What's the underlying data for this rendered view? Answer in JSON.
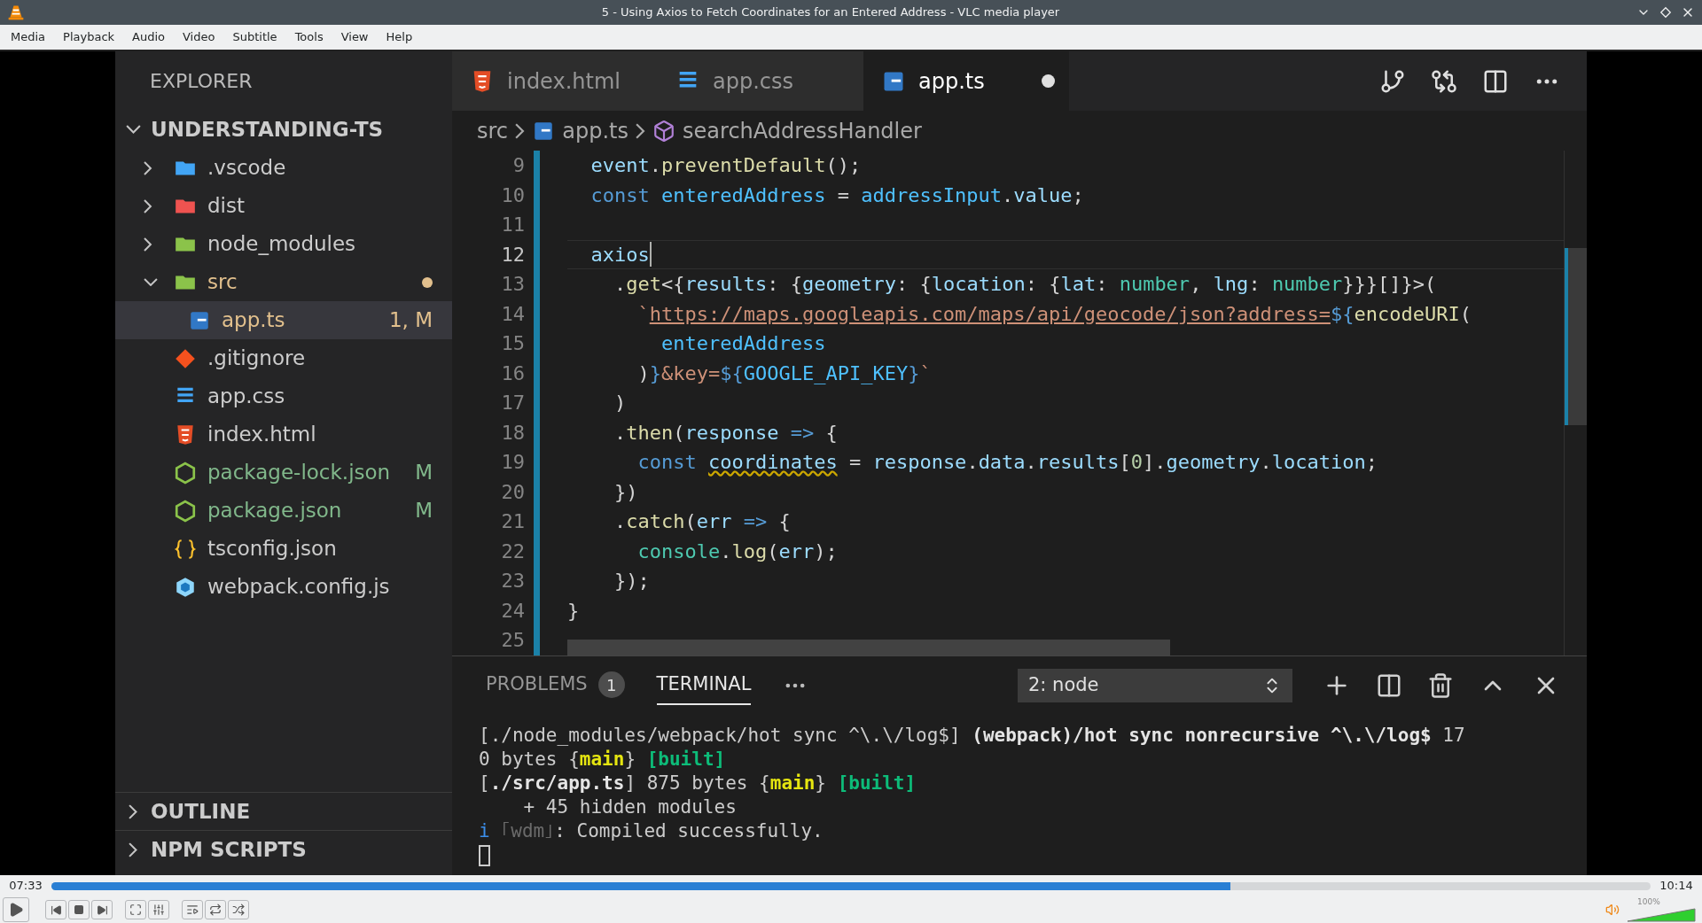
{
  "window": {
    "title": "5 - Using Axios to Fetch Coordinates for an Entered Address - VLC media player"
  },
  "menu": [
    "Media",
    "Playback",
    "Audio",
    "Video",
    "Subtitle",
    "Tools",
    "View",
    "Help"
  ],
  "explorer": {
    "title": "EXPLORER",
    "root": {
      "label": "UNDERSTANDING-TS",
      "expanded": true,
      "children": [
        {
          "label": ".vscode",
          "kind": "folder-blue",
          "expanded": false,
          "selected": false
        },
        {
          "label": "dist",
          "kind": "folder-red",
          "expanded": false,
          "selected": false
        },
        {
          "label": "node_modules",
          "kind": "folder-green",
          "expanded": false,
          "selected": false
        },
        {
          "label": "src",
          "kind": "folder-green",
          "expanded": true,
          "selected": false,
          "modified": true,
          "color": "#e2c08d",
          "children": [
            {
              "label": "app.ts",
              "kind": "ts",
              "selected": true,
              "color": "#e2c08d",
              "status": "1, M"
            }
          ]
        },
        {
          "label": ".gitignore",
          "kind": "git",
          "selected": false
        },
        {
          "label": "app.css",
          "kind": "css",
          "selected": false
        },
        {
          "label": "index.html",
          "kind": "html",
          "selected": false
        },
        {
          "label": "package-lock.json",
          "kind": "node",
          "selected": false,
          "color": "#81b88b",
          "status": "M"
        },
        {
          "label": "package.json",
          "kind": "node",
          "selected": false,
          "color": "#81b88b",
          "status": "M"
        },
        {
          "label": "tsconfig.json",
          "kind": "json",
          "selected": false
        },
        {
          "label": "webpack.config.js",
          "kind": "webpack",
          "selected": false
        }
      ]
    },
    "sections": [
      {
        "label": "OUTLINE",
        "expanded": false
      },
      {
        "label": "NPM SCRIPTS",
        "expanded": false
      }
    ]
  },
  "tabs": [
    {
      "label": "index.html",
      "kind": "html",
      "selected": false,
      "modified": false
    },
    {
      "label": "app.css",
      "kind": "css",
      "selected": false,
      "modified": false
    },
    {
      "label": "app.ts",
      "kind": "ts",
      "selected": true,
      "modified": true
    }
  ],
  "breadcrumb": [
    {
      "label": "src",
      "kind": "folder"
    },
    {
      "label": "app.ts",
      "kind": "ts"
    },
    {
      "label": "searchAddressHandler",
      "kind": "symbol"
    }
  ],
  "code": {
    "lines": [
      {
        "number": "9",
        "active": false,
        "tokens": [
          {
            "text": "  event",
            "kind": "var"
          },
          {
            "text": ".",
            "kind": "plain"
          },
          {
            "text": "preventDefault",
            "kind": "fn"
          },
          {
            "text": "();",
            "kind": "plain"
          }
        ]
      },
      {
        "number": "10",
        "active": false,
        "tokens": [
          {
            "text": "  const",
            "kind": "kw"
          },
          {
            "text": " enteredAddress",
            "kind": "const"
          },
          {
            "text": " = ",
            "kind": "plain"
          },
          {
            "text": "addressInput",
            "kind": "const"
          },
          {
            "text": ".",
            "kind": "plain"
          },
          {
            "text": "value",
            "kind": "var"
          },
          {
            "text": ";",
            "kind": "plain"
          }
        ]
      },
      {
        "number": "11",
        "active": false
      },
      {
        "number": "12",
        "active": true,
        "tokens": [
          {
            "text": "  axios",
            "kind": "var"
          }
        ]
      },
      {
        "number": "13",
        "active": false,
        "tokens": [
          {
            "text": "    .",
            "kind": "plain"
          },
          {
            "text": "get",
            "kind": "fn"
          },
          {
            "text": "<{",
            "kind": "plain"
          },
          {
            "text": "results",
            "kind": "var"
          },
          {
            "text": ": {",
            "kind": "plain"
          },
          {
            "text": "geometry",
            "kind": "var"
          },
          {
            "text": ": {",
            "kind": "plain"
          },
          {
            "text": "location",
            "kind": "var"
          },
          {
            "text": ": {",
            "kind": "plain"
          },
          {
            "text": "lat",
            "kind": "var"
          },
          {
            "text": ": ",
            "kind": "plain"
          },
          {
            "text": "number",
            "kind": "type"
          },
          {
            "text": ", ",
            "kind": "plain"
          },
          {
            "text": "lng",
            "kind": "var"
          },
          {
            "text": ": ",
            "kind": "plain"
          },
          {
            "text": "number",
            "kind": "type"
          },
          {
            "text": "}}}[]}>(",
            "kind": "plain"
          }
        ]
      },
      {
        "number": "14",
        "active": false,
        "tokens": [
          {
            "text": "      `",
            "kind": "str"
          },
          {
            "text": "https://maps.googleapis.com/maps/api/geocode/json?address=",
            "kind": "link"
          },
          {
            "text": "${",
            "kind": "tmpl"
          },
          {
            "text": "encodeURI",
            "kind": "fn"
          },
          {
            "text": "(",
            "kind": "plain"
          }
        ]
      },
      {
        "number": "15",
        "active": false,
        "tokens": [
          {
            "text": "        enteredAddress",
            "kind": "const"
          }
        ]
      },
      {
        "number": "16",
        "active": false,
        "tokens": [
          {
            "text": "      )",
            "kind": "plain"
          },
          {
            "text": "}",
            "kind": "tmpl"
          },
          {
            "text": "&key=",
            "kind": "str"
          },
          {
            "text": "${",
            "kind": "tmpl"
          },
          {
            "text": "GOOGLE_API_KEY",
            "kind": "const"
          },
          {
            "text": "}",
            "kind": "tmpl"
          },
          {
            "text": "`",
            "kind": "str"
          }
        ]
      },
      {
        "number": "17",
        "active": false,
        "tokens": [
          {
            "text": "    )",
            "kind": "plain"
          }
        ]
      },
      {
        "number": "18",
        "active": false,
        "tokens": [
          {
            "text": "    .",
            "kind": "plain"
          },
          {
            "text": "then",
            "kind": "fn"
          },
          {
            "text": "(",
            "kind": "plain"
          },
          {
            "text": "response",
            "kind": "var"
          },
          {
            "text": " =>",
            "kind": "kw"
          },
          {
            "text": " {",
            "kind": "plain"
          }
        ]
      },
      {
        "number": "19",
        "active": false,
        "tokens": [
          {
            "text": "      const ",
            "kind": "kw"
          },
          {
            "text": "coordinates",
            "kind": "warn"
          },
          {
            "text": " = ",
            "kind": "plain"
          },
          {
            "text": "response",
            "kind": "var"
          },
          {
            "text": ".",
            "kind": "plain"
          },
          {
            "text": "data",
            "kind": "var"
          },
          {
            "text": ".",
            "kind": "plain"
          },
          {
            "text": "results",
            "kind": "var"
          },
          {
            "text": "[",
            "kind": "plain"
          },
          {
            "text": "0",
            "kind": "num"
          },
          {
            "text": "].",
            "kind": "plain"
          },
          {
            "text": "geometry",
            "kind": "var"
          },
          {
            "text": ".",
            "kind": "plain"
          },
          {
            "text": "location",
            "kind": "var"
          },
          {
            "text": ";",
            "kind": "plain"
          }
        ]
      },
      {
        "number": "20",
        "active": false,
        "tokens": [
          {
            "text": "    })",
            "kind": "plain"
          }
        ]
      },
      {
        "number": "21",
        "active": false,
        "tokens": [
          {
            "text": "    .",
            "kind": "plain"
          },
          {
            "text": "catch",
            "kind": "fn"
          },
          {
            "text": "(",
            "kind": "plain"
          },
          {
            "text": "err",
            "kind": "var"
          },
          {
            "text": " =>",
            "kind": "kw"
          },
          {
            "text": " {",
            "kind": "plain"
          }
        ]
      },
      {
        "number": "22",
        "active": false,
        "tokens": [
          {
            "text": "      console",
            "kind": "type"
          },
          {
            "text": ".",
            "kind": "plain"
          },
          {
            "text": "log",
            "kind": "fn"
          },
          {
            "text": "(",
            "kind": "plain"
          },
          {
            "text": "err",
            "kind": "var"
          },
          {
            "text": ");",
            "kind": "plain"
          }
        ]
      },
      {
        "number": "23",
        "active": false,
        "tokens": [
          {
            "text": "    });",
            "kind": "plain"
          }
        ]
      },
      {
        "number": "24",
        "active": false,
        "tokens": [
          {
            "text": "}",
            "kind": "plain"
          }
        ]
      },
      {
        "number": "25",
        "active": false
      }
    ]
  },
  "panel": {
    "tabs": [
      {
        "label": "PROBLEMS",
        "badge": "1",
        "selected": false
      },
      {
        "label": "TERMINAL",
        "selected": true
      }
    ],
    "terminal_select": "2: node",
    "terminal": [
      {
        "kind": "text",
        "tokens": [
          {
            "text": "[./node_modules/webpack/hot sync ^\\.\\/log$] ",
            "kind": "plain"
          },
          {
            "text": "(webpack)/hot sync nonrecursive ^\\.\\/log$",
            "kind": "bold"
          },
          {
            "text": " 17",
            "kind": "plain"
          }
        ]
      },
      {
        "kind": "text",
        "tokens": [
          {
            "text": "0 bytes {",
            "kind": "plain"
          },
          {
            "text": "main",
            "kind": "yellow"
          },
          {
            "text": "} ",
            "kind": "plain"
          },
          {
            "text": "[built]",
            "kind": "green"
          }
        ]
      },
      {
        "kind": "text",
        "tokens": [
          {
            "text": "[",
            "kind": "plain"
          },
          {
            "text": "./src/app.ts",
            "kind": "bold"
          },
          {
            "text": "] 875 bytes {",
            "kind": "plain"
          },
          {
            "text": "main",
            "kind": "yellow"
          },
          {
            "text": "} ",
            "kind": "plain"
          },
          {
            "text": "[built]",
            "kind": "green"
          }
        ]
      },
      {
        "kind": "text",
        "tokens": [
          {
            "text": "    + 45 hidden modules",
            "kind": "plain"
          }
        ]
      },
      {
        "kind": "text",
        "tokens": [
          {
            "text": "i",
            "kind": "info"
          },
          {
            "text": " ｢wdm｣",
            "kind": "dim"
          },
          {
            "text": ": Compiled successfully.",
            "kind": "plain"
          }
        ]
      },
      {
        "kind": "cursor"
      }
    ]
  },
  "player": {
    "elapsed": "07:33",
    "total": "10:14",
    "level": 0.737,
    "playing": false,
    "volume": {
      "label": "100%",
      "level": 1.0
    }
  }
}
